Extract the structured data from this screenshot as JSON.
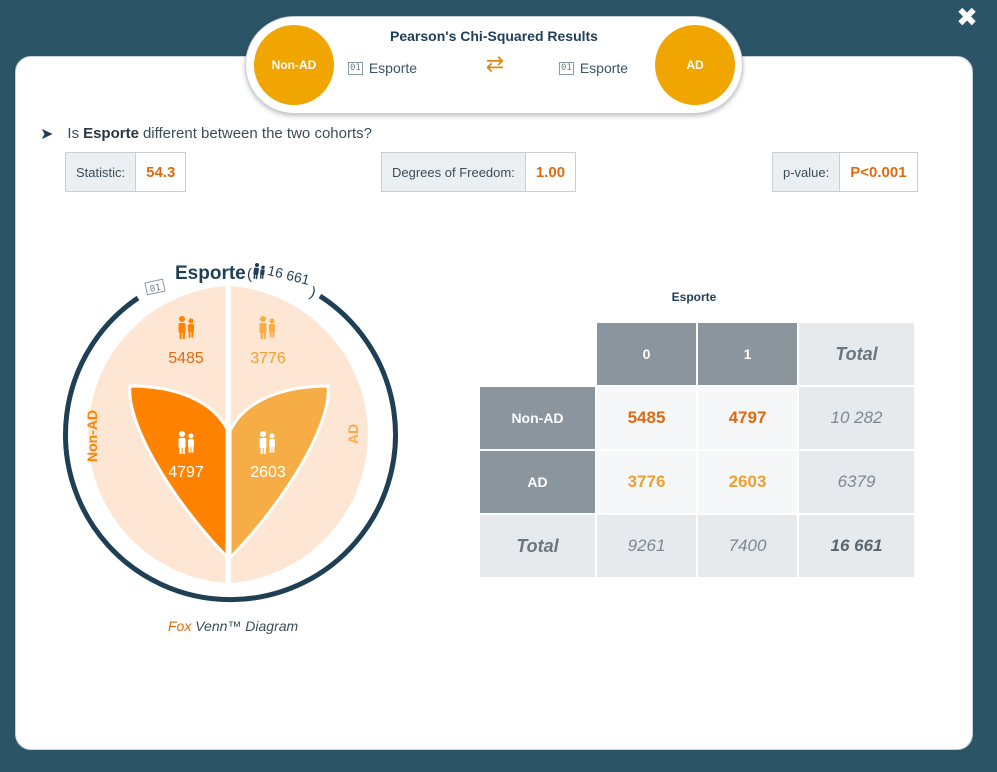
{
  "window": {
    "close_glyph": "✖"
  },
  "header": {
    "title": "Pearson's Chi-Squared Results",
    "left_cohort": "Non-AD",
    "right_cohort": "AD",
    "left_variable": "Esporte",
    "right_variable": "Esporte",
    "binary_icon_text": "01",
    "swap_glyph": "⇄"
  },
  "question": {
    "prefix": "Is",
    "variable": "Esporte",
    "suffix": "different between the two cohorts?"
  },
  "stats": {
    "statistic_label": "Statistic:",
    "statistic_value": "54.3",
    "dof_label": "Degrees of Freedom:",
    "dof_value": "1.00",
    "p_label": "p-value:",
    "p_value": "P<0.001"
  },
  "venn": {
    "variable": "Esporte",
    "total_open": "(",
    "total": "16 661",
    "total_close": ")",
    "binary_icon_text": "01",
    "left_label": "Non-AD",
    "right_label": "AD",
    "nonad_0": "5485",
    "ad_0": "3776",
    "nonad_1": "4797",
    "ad_1": "2603",
    "caption_brand": "Fox",
    "caption_rest": "Venn™ Diagram",
    "colors": {
      "outer_ring": "#1f3f55",
      "light_fill": "#fde6d3",
      "dark_fill": "#ff8200",
      "mid_fill": "#f7ad45",
      "text_dark": "#e06a10",
      "text_light": "#f0a030"
    }
  },
  "table": {
    "variable": "Esporte",
    "col_headers": [
      "0",
      "1",
      "Total"
    ],
    "rows": [
      {
        "label": "Non-AD",
        "values": [
          "5485",
          "4797"
        ],
        "total": "10 282"
      },
      {
        "label": "AD",
        "values": [
          "3776",
          "2603"
        ],
        "total": "6379"
      }
    ],
    "total_label": "Total",
    "col_totals": [
      "9261",
      "7400"
    ],
    "grand_total": "16 661"
  },
  "icons": {
    "close": "close-icon",
    "swap": "swap-arrows-icon",
    "arrow": "play-arrow-icon",
    "people": "people-icon",
    "binary": "binary-variable-icon"
  }
}
